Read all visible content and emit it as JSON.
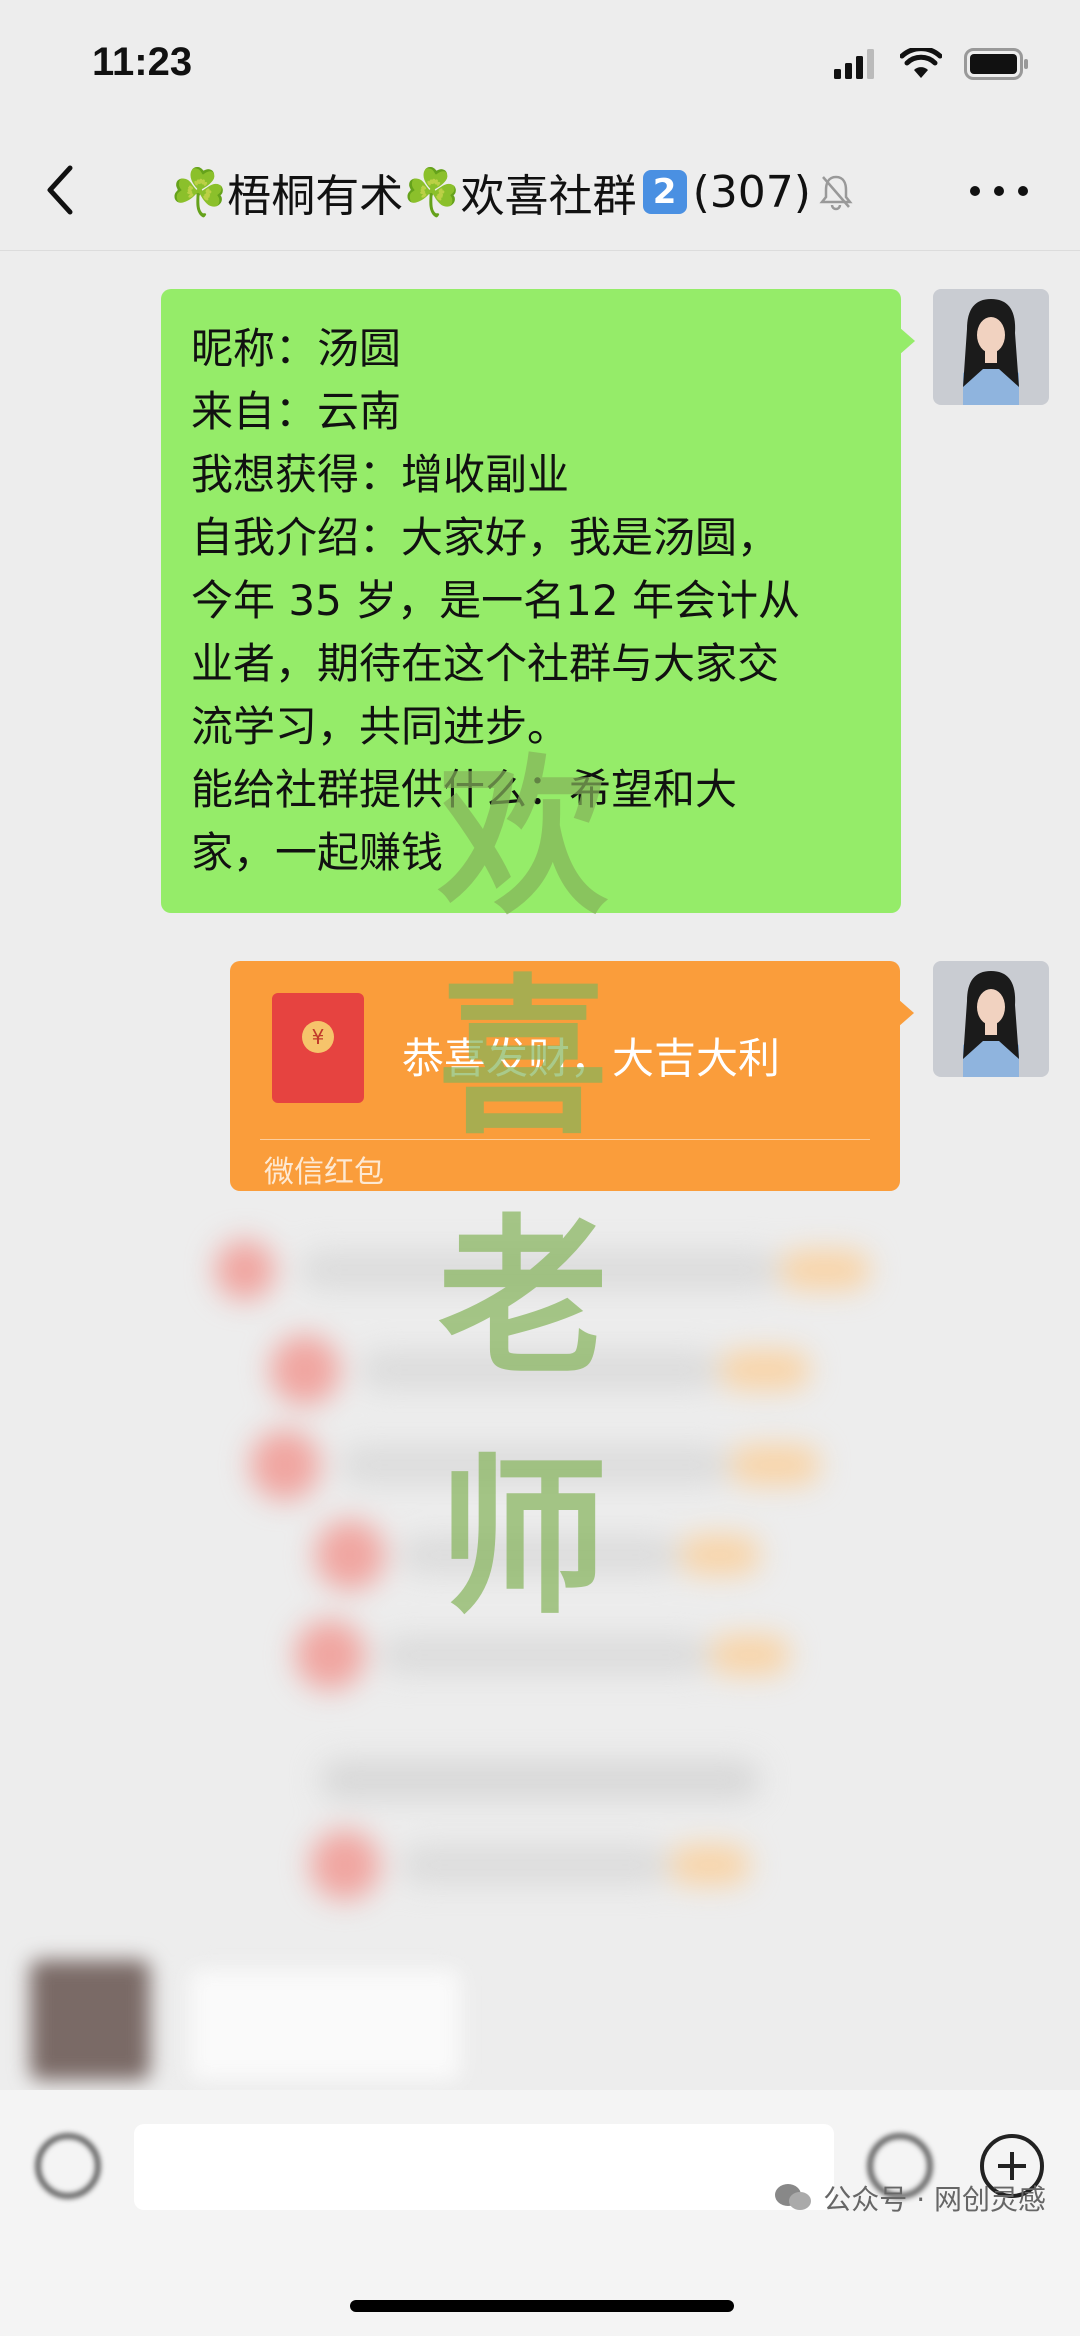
{
  "status": {
    "time": "11:23"
  },
  "nav": {
    "title_prefix": "☘️",
    "title_name": "梧桐有术",
    "title_middle": "☘️",
    "title_suffix": "欢喜社群",
    "title_badge": "2",
    "member_count": "(307)"
  },
  "messages": {
    "intro_lines": [
      "昵称：汤圆",
      "来自：云南",
      "我想获得：增收副业",
      "自我介绍：大家好，我是汤圆，",
      "今年 35 岁，是一名12 年会计从",
      "业者，期待在这个社群与大家交",
      "流学习，共同进步。",
      "能给社群提供什么：希望和大",
      "家，一起赚钱"
    ],
    "red_packet": {
      "greeting": "恭喜发财，大吉大利",
      "label": "微信红包",
      "seal": "¥"
    }
  },
  "watermark": {
    "chars": [
      "欢",
      "喜",
      "老",
      "师"
    ]
  },
  "footer": {
    "source": "公众号 · 网创灵感"
  },
  "colors": {
    "bubble_green": "#95ec69",
    "red_packet_orange": "#fa9d3b",
    "background": "#ededed"
  }
}
